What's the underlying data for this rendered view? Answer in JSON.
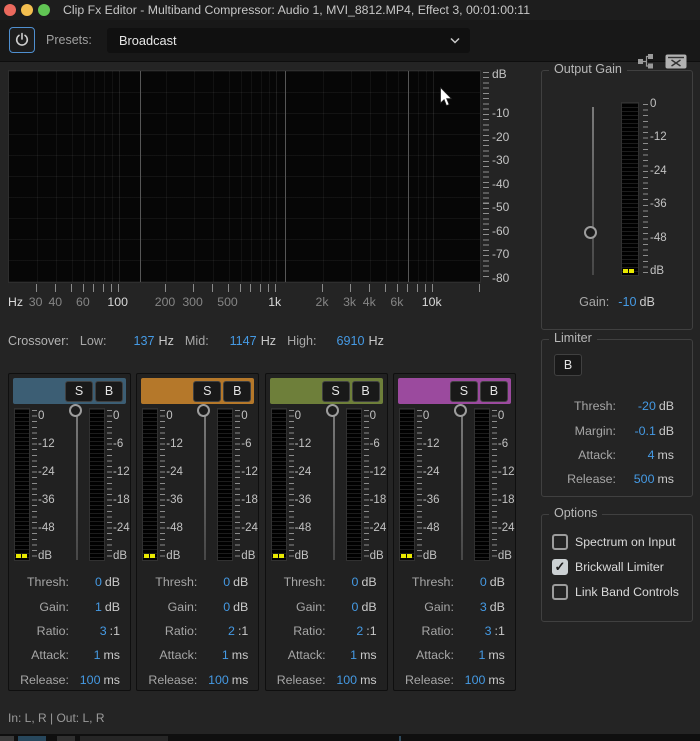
{
  "colors": {
    "accent_blue": "#459ae4",
    "peak_yellow": "#e8e800",
    "band_colors": [
      "#3c5e74",
      "#b5782a",
      "#6e7f3a",
      "#9b4a9e"
    ],
    "traffic_lights": [
      "#ec6a5e",
      "#f4bf4f",
      "#61c554"
    ]
  },
  "icons": {
    "power": "power-icon",
    "chevron": "chevron-down-icon",
    "routing": "routing-icon",
    "close_box": "close-editor-icon",
    "cursor": "arrow-cursor",
    "check_glyph": "✓"
  },
  "titlebar": {
    "title": "Clip Fx Editor - Multiband Compressor: Audio 1, MVI_8812.MP4, Effect 3, 00:01:00:11",
    "traffic_light_colors": [
      "#ec6a5e",
      "#f4bf4f",
      "#61c554"
    ]
  },
  "toolbar": {
    "presets_label": "Presets:",
    "preset_value": "Broadcast"
  },
  "spectrum": {
    "freq_unit": "Hz",
    "db_label": "dB",
    "db_ticks": [
      "-10",
      "-20",
      "-30",
      "-40",
      "-50",
      "-60",
      "-70",
      "-80"
    ],
    "freq_min_hz": 20,
    "freq_max_hz": 20000,
    "freq_ticks": [
      30,
      40,
      50,
      60,
      70,
      80,
      90,
      100,
      200,
      300,
      400,
      500,
      600,
      700,
      800,
      900,
      1000,
      2000,
      3000,
      4000,
      5000,
      6000,
      7000,
      8000,
      9000,
      10000,
      20000
    ],
    "freq_labels": [
      {
        "f": 30,
        "text": "30",
        "bright": false
      },
      {
        "f": 40,
        "text": "40",
        "bright": false
      },
      {
        "f": 60,
        "text": "60",
        "bright": false
      },
      {
        "f": 100,
        "text": "100",
        "bright": true
      },
      {
        "f": 200,
        "text": "200",
        "bright": false
      },
      {
        "f": 300,
        "text": "300",
        "bright": false
      },
      {
        "f": 500,
        "text": "500",
        "bright": false
      },
      {
        "f": 1000,
        "text": "1k",
        "bright": true
      },
      {
        "f": 2000,
        "text": "2k",
        "bright": false
      },
      {
        "f": 3000,
        "text": "3k",
        "bright": false
      },
      {
        "f": 4000,
        "text": "4k",
        "bright": false
      },
      {
        "f": 6000,
        "text": "6k",
        "bright": false
      },
      {
        "f": 10000,
        "text": "10k",
        "bright": true
      }
    ],
    "crossover_lines_hz": [
      137,
      1147,
      6910
    ]
  },
  "crossover": {
    "label": "Crossover:",
    "fields": [
      {
        "label": "Low:",
        "value": "137",
        "unit": "Hz"
      },
      {
        "label": "Mid:",
        "value": "1147",
        "unit": "Hz"
      },
      {
        "label": "High:",
        "value": "6910",
        "unit": "Hz"
      }
    ]
  },
  "band_meter": {
    "level_scale": [
      "0",
      "-12",
      "-24",
      "-36",
      "-48",
      "dB"
    ],
    "reduction_scale": [
      "0",
      "-6",
      "-12",
      "-18",
      "-24",
      "dB"
    ]
  },
  "bands": [
    {
      "color": "#3c5e74",
      "solo_label": "S",
      "bypass_label": "B",
      "slider_position": 0.01,
      "params": [
        {
          "label": "Thresh:",
          "value": "0",
          "unit": "dB"
        },
        {
          "label": "Gain:",
          "value": "1",
          "unit": "dB"
        },
        {
          "label": "Ratio:",
          "value": "3",
          "unit": ":1"
        },
        {
          "label": "Attack:",
          "value": "1",
          "unit": "ms"
        },
        {
          "label": "Release:",
          "value": "100",
          "unit": "ms"
        }
      ]
    },
    {
      "color": "#b5782a",
      "solo_label": "S",
      "bypass_label": "B",
      "slider_position": 0.01,
      "params": [
        {
          "label": "Thresh:",
          "value": "0",
          "unit": "dB"
        },
        {
          "label": "Gain:",
          "value": "0",
          "unit": "dB"
        },
        {
          "label": "Ratio:",
          "value": "2",
          "unit": ":1"
        },
        {
          "label": "Attack:",
          "value": "1",
          "unit": "ms"
        },
        {
          "label": "Release:",
          "value": "100",
          "unit": "ms"
        }
      ]
    },
    {
      "color": "#6e7f3a",
      "solo_label": "S",
      "bypass_label": "B",
      "slider_position": 0.01,
      "params": [
        {
          "label": "Thresh:",
          "value": "0",
          "unit": "dB"
        },
        {
          "label": "Gain:",
          "value": "0",
          "unit": "dB"
        },
        {
          "label": "Ratio:",
          "value": "2",
          "unit": ":1"
        },
        {
          "label": "Attack:",
          "value": "1",
          "unit": "ms"
        },
        {
          "label": "Release:",
          "value": "100",
          "unit": "ms"
        }
      ]
    },
    {
      "color": "#9b4a9e",
      "solo_label": "S",
      "bypass_label": "B",
      "slider_position": 0.01,
      "params": [
        {
          "label": "Thresh:",
          "value": "0",
          "unit": "dB"
        },
        {
          "label": "Gain:",
          "value": "3",
          "unit": "dB"
        },
        {
          "label": "Ratio:",
          "value": "3",
          "unit": ":1"
        },
        {
          "label": "Attack:",
          "value": "1",
          "unit": "ms"
        },
        {
          "label": "Release:",
          "value": "100",
          "unit": "ms"
        }
      ]
    }
  ],
  "output_gain": {
    "title": "Output Gain",
    "scale": [
      "0",
      "-12",
      "-24",
      "-36",
      "-48",
      "dB"
    ],
    "gain_label": "Gain:",
    "gain_value": "-10",
    "gain_unit": "dB",
    "slider_position": 0.76
  },
  "limiter": {
    "title": "Limiter",
    "bypass_label": "B",
    "params": [
      {
        "label": "Thresh:",
        "value": "-20",
        "unit": "dB"
      },
      {
        "label": "Margin:",
        "value": "-0.1",
        "unit": "dB"
      },
      {
        "label": "Attack:",
        "value": "4",
        "unit": "ms"
      },
      {
        "label": "Release:",
        "value": "500",
        "unit": "ms"
      }
    ]
  },
  "options": {
    "title": "Options",
    "items": [
      {
        "label": "Spectrum on Input",
        "checked": false
      },
      {
        "label": "Brickwall Limiter",
        "checked": true
      },
      {
        "label": "Link Band Controls",
        "checked": false
      }
    ]
  },
  "status": {
    "io": "In: L, R | Out: L, R"
  }
}
